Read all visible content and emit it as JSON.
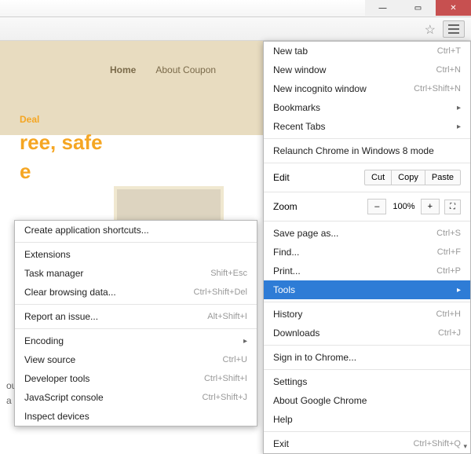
{
  "page": {
    "nav": {
      "home": "Home",
      "about": "About Coupon"
    },
    "hero_line1": "Deal",
    "hero_line2": "ree, safe",
    "hero_line3": "e",
    "sidetext_1": "ou",
    "sidetext_2": "a"
  },
  "menu": {
    "new_tab": {
      "label": "New tab",
      "sc": "Ctrl+T"
    },
    "new_window": {
      "label": "New window",
      "sc": "Ctrl+N"
    },
    "incognito": {
      "label": "New incognito window",
      "sc": "Ctrl+Shift+N"
    },
    "bookmarks": {
      "label": "Bookmarks"
    },
    "recent": {
      "label": "Recent Tabs"
    },
    "relaunch": {
      "label": "Relaunch Chrome in Windows 8 mode"
    },
    "edit": {
      "label": "Edit",
      "cut": "Cut",
      "copy": "Copy",
      "paste": "Paste"
    },
    "zoom": {
      "label": "Zoom",
      "minus": "–",
      "value": "100%",
      "plus": "+"
    },
    "save": {
      "label": "Save page as...",
      "sc": "Ctrl+S"
    },
    "find": {
      "label": "Find...",
      "sc": "Ctrl+F"
    },
    "print": {
      "label": "Print...",
      "sc": "Ctrl+P"
    },
    "tools": {
      "label": "Tools"
    },
    "history": {
      "label": "History",
      "sc": "Ctrl+H"
    },
    "downloads": {
      "label": "Downloads",
      "sc": "Ctrl+J"
    },
    "signin": {
      "label": "Sign in to Chrome..."
    },
    "settings": {
      "label": "Settings"
    },
    "about": {
      "label": "About Google Chrome"
    },
    "help": {
      "label": "Help"
    },
    "exit": {
      "label": "Exit",
      "sc": "Ctrl+Shift+Q"
    }
  },
  "submenu": {
    "create_shortcuts": {
      "label": "Create application shortcuts..."
    },
    "extensions": {
      "label": "Extensions"
    },
    "task_manager": {
      "label": "Task manager",
      "sc": "Shift+Esc"
    },
    "clear_data": {
      "label": "Clear browsing data...",
      "sc": "Ctrl+Shift+Del"
    },
    "report": {
      "label": "Report an issue...",
      "sc": "Alt+Shift+I"
    },
    "encoding": {
      "label": "Encoding"
    },
    "view_source": {
      "label": "View source",
      "sc": "Ctrl+U"
    },
    "dev_tools": {
      "label": "Developer tools",
      "sc": "Ctrl+Shift+I"
    },
    "js_console": {
      "label": "JavaScript console",
      "sc": "Ctrl+Shift+J"
    },
    "inspect": {
      "label": "Inspect devices"
    }
  }
}
